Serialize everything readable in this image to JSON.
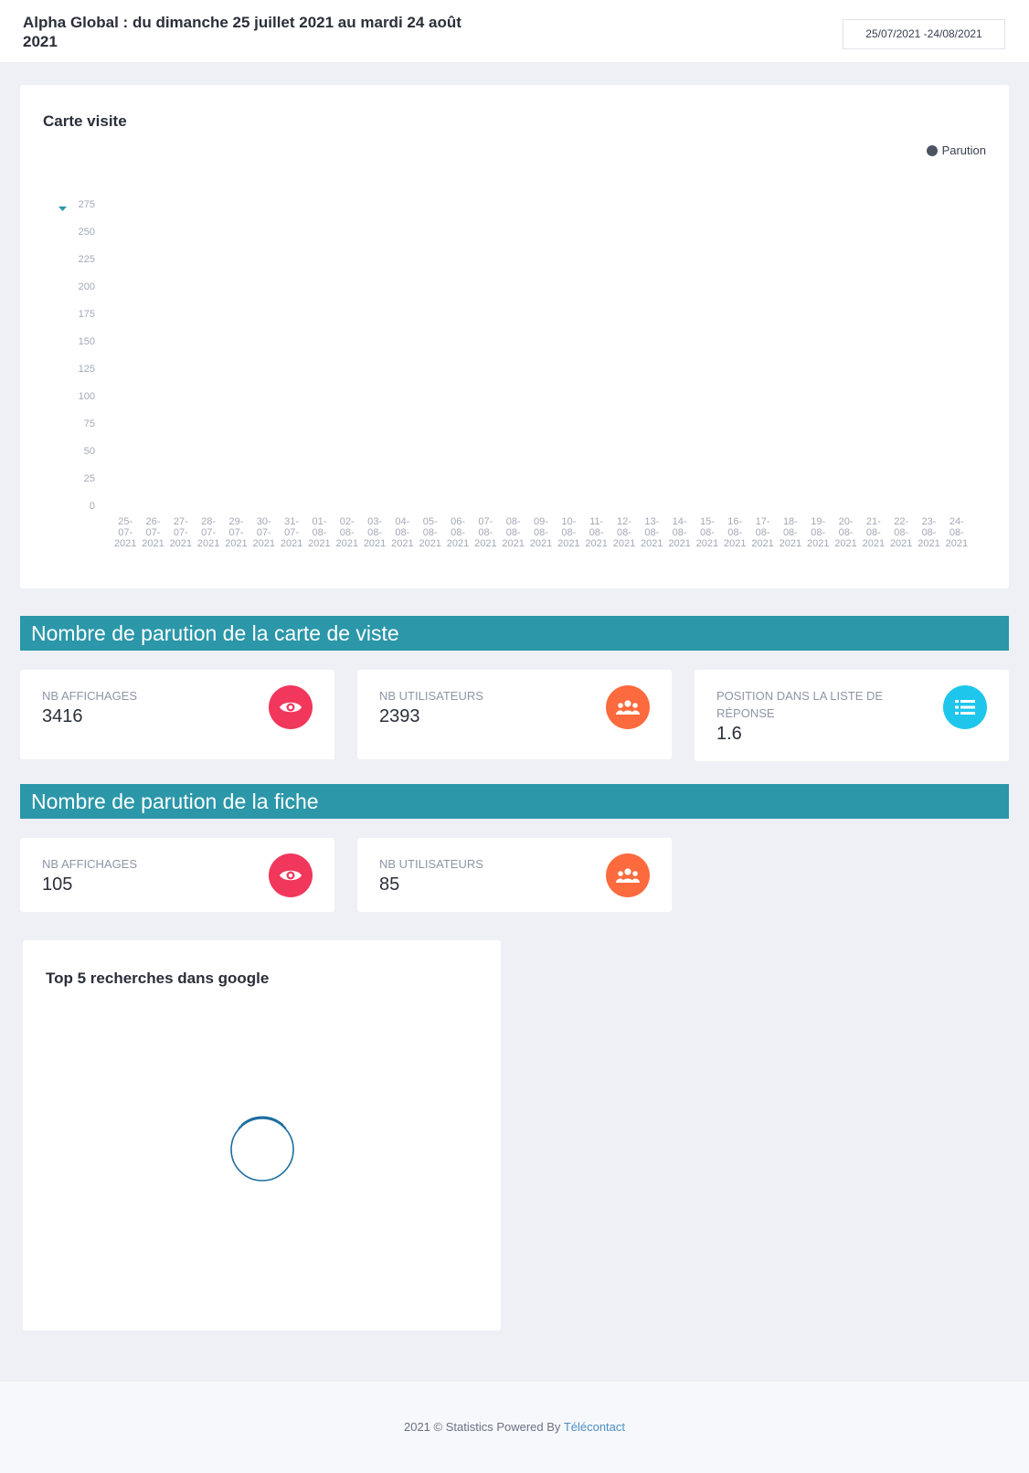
{
  "header": {
    "title": "Alpha Global : du dimanche 25 juillet 2021 au mardi 24 août 2021",
    "date_range": "25/07/2021 -24/08/2021"
  },
  "visit_card": {
    "title": "Carte visite"
  },
  "chart_data": {
    "type": "bar",
    "legend": [
      "Parution"
    ],
    "legend_position": "top-right",
    "y_ticks": [
      0,
      25,
      50,
      75,
      100,
      125,
      150,
      175,
      200,
      225,
      250,
      275
    ],
    "ylim": [
      0,
      275
    ],
    "categories": [
      "25-07-2021",
      "26-07-2021",
      "27-07-2021",
      "28-07-2021",
      "29-07-2021",
      "30-07-2021",
      "31-07-2021",
      "01-08-2021",
      "02-08-2021",
      "03-08-2021",
      "04-08-2021",
      "05-08-2021",
      "06-08-2021",
      "07-08-2021",
      "08-08-2021",
      "09-08-2021",
      "10-08-2021",
      "11-08-2021",
      "12-08-2021",
      "13-08-2021",
      "14-08-2021",
      "15-08-2021",
      "16-08-2021",
      "17-08-2021",
      "18-08-2021",
      "19-08-2021",
      "20-08-2021",
      "21-08-2021",
      "22-08-2021",
      "23-08-2021",
      "24-08-2021"
    ],
    "series": [
      {
        "name": "Parution",
        "color": "#4a5463",
        "values": []
      }
    ],
    "grid": false
  },
  "section_card": {
    "title": "Nombre de parution de la carte de viste",
    "stats": [
      {
        "label": "NB AFFICHAGES",
        "value": "3416",
        "icon": "eye-icon",
        "color": "#f1375c"
      },
      {
        "label": "NB UTILISATEURS",
        "value": "2393",
        "icon": "users-icon",
        "color": "#fc6a3d"
      },
      {
        "label": "POSITION DANS LA LISTE DE RÉPONSE",
        "value": "1.6",
        "icon": "list-icon",
        "color": "#1ec6ec"
      }
    ]
  },
  "section_fiche": {
    "title": "Nombre de parution de la fiche",
    "stats": [
      {
        "label": "NB AFFICHAGES",
        "value": "105",
        "icon": "eye-icon",
        "color": "#f1375c"
      },
      {
        "label": "NB UTILISATEURS",
        "value": "85",
        "icon": "users-icon",
        "color": "#fc6a3d"
      }
    ]
  },
  "google_card": {
    "title": "Top 5 recherches dans google"
  },
  "footer": {
    "text": "2021 © Statistics Powered By ",
    "link": "Télécontact"
  },
  "colors": {
    "banner": "#2b97a9",
    "accent_link": "#4d8dc4",
    "spinner": "#1e6ea0"
  }
}
